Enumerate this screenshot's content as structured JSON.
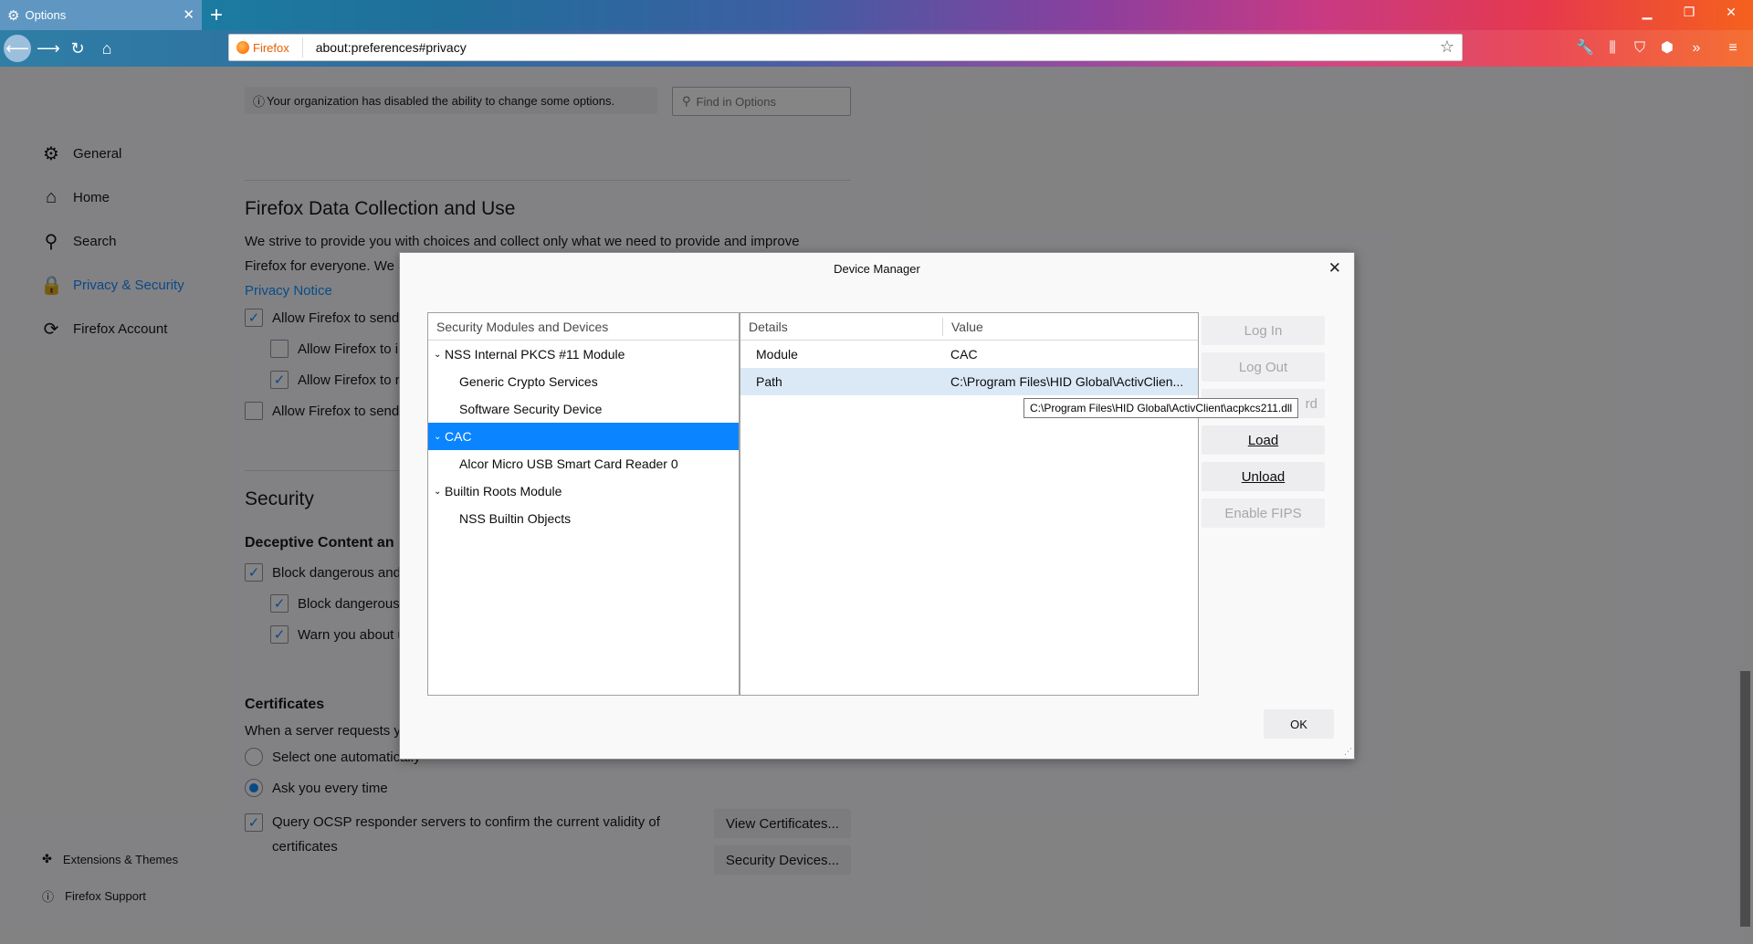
{
  "browser": {
    "tab_title": "Options",
    "identity_label": "Firefox",
    "url": "about:preferences#privacy"
  },
  "prefs": {
    "org_notice": "Your organization has disabled the ability to change some options.",
    "find_placeholder": "Find in Options",
    "categories": [
      {
        "label": "General",
        "icon": "gear-icon"
      },
      {
        "label": "Home",
        "icon": "home-icon"
      },
      {
        "label": "Search",
        "icon": "search-icon"
      },
      {
        "label": "Privacy & Security",
        "icon": "lock-icon"
      },
      {
        "label": "Firefox Account",
        "icon": "sync-icon"
      }
    ],
    "footer": {
      "extensions": "Extensions & Themes",
      "support": "Firefox Support"
    },
    "data_collection": {
      "title": "Firefox Data Collection and Use",
      "desc_line1": "We strive to provide you with choices and collect only what we need to provide and improve",
      "desc_line2": "Firefox for everyone. We a",
      "privacy_link": "Privacy Notice",
      "opt1": "Allow Firefox to send",
      "opt2": "Allow Firefox to i",
      "opt3": "Allow Firefox to r",
      "opt4": "Allow Firefox to send"
    },
    "security": {
      "title": "Security",
      "deceptive_heading": "Deceptive Content an",
      "block_dangerous": "Block dangerous and",
      "block_downloads": "Block dangerous",
      "warn_unwanted": "Warn you about u"
    },
    "certificates": {
      "heading": "Certificates",
      "desc": "When a server requests yo",
      "select_auto": "Select one automatically",
      "ask_every": "Ask you every time",
      "ocsp_line1": "Query OCSP responder servers to confirm the current validity of",
      "ocsp_line2": "certificates",
      "view_btn": "View Certificates...",
      "devices_btn": "Security Devices..."
    }
  },
  "dialog": {
    "title": "Device Manager",
    "tree_header": "Security Modules and Devices",
    "tree": [
      {
        "label": "NSS Internal PKCS #11 Module",
        "level": 0
      },
      {
        "label": "Generic Crypto Services",
        "level": 1
      },
      {
        "label": "Software Security Device",
        "level": 1
      },
      {
        "label": "CAC",
        "level": 0
      },
      {
        "label": "Alcor Micro USB Smart Card Reader 0",
        "level": 1
      },
      {
        "label": "Builtin Roots Module",
        "level": 0
      },
      {
        "label": "NSS Builtin Objects",
        "level": 1
      }
    ],
    "details_header": "Details",
    "value_header": "Value",
    "details": [
      {
        "name": "Module",
        "value": "CAC"
      },
      {
        "name": "Path",
        "value": "C:\\Program Files\\HID Global\\ActivClien..."
      }
    ],
    "tooltip": "C:\\Program Files\\HID Global\\ActivClient\\acpkcs211.dll",
    "buttons": {
      "login": "Log In",
      "logout": "Log Out",
      "password_fragment": "rd",
      "load": "Load",
      "unload": "Unload",
      "fips": "Enable FIPS",
      "ok": "OK"
    }
  }
}
